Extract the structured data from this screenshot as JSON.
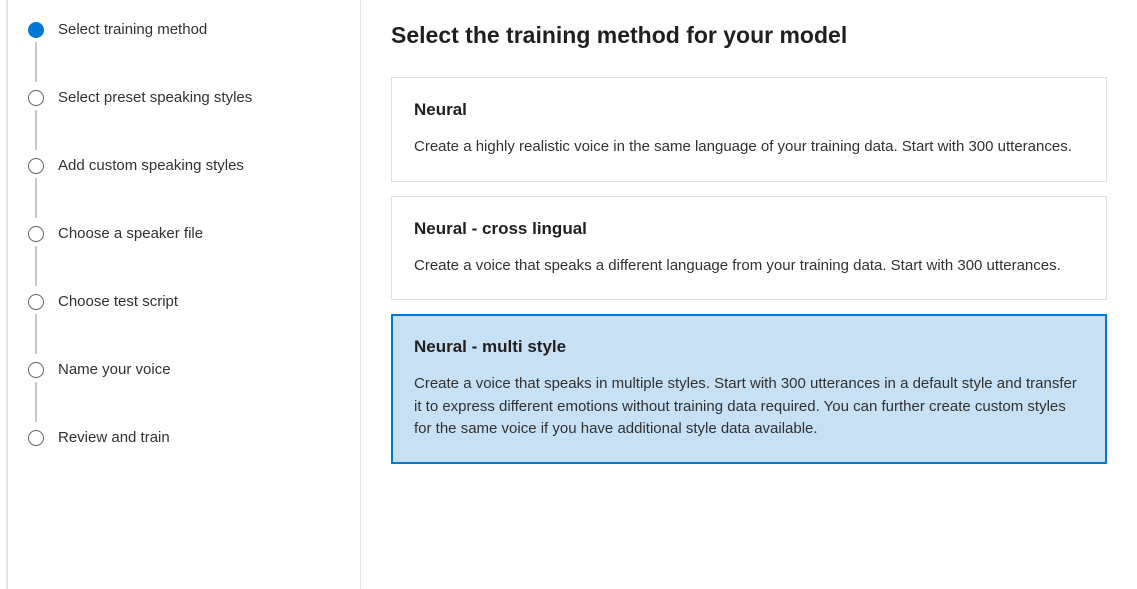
{
  "sidebar": {
    "steps": [
      {
        "label": "Select training method",
        "active": true
      },
      {
        "label": "Select preset speaking styles",
        "active": false
      },
      {
        "label": "Add custom speaking styles",
        "active": false
      },
      {
        "label": "Choose a speaker file",
        "active": false
      },
      {
        "label": "Choose test script",
        "active": false
      },
      {
        "label": "Name your voice",
        "active": false
      },
      {
        "label": "Review and train",
        "active": false
      }
    ]
  },
  "main": {
    "title": "Select the training method for your model",
    "options": [
      {
        "title": "Neural",
        "desc": "Create a highly realistic voice in the same language of your training data. Start with 300 utterances.",
        "selected": false
      },
      {
        "title": "Neural - cross lingual",
        "desc": "Create a voice that speaks a different language from your training data. Start with 300 utterances.",
        "selected": false
      },
      {
        "title": "Neural - multi style",
        "desc": "Create a voice that speaks in multiple styles. Start with 300 utterances in a default style and transfer it to express different emotions without training data required. You can further create custom styles for the same voice if you have additional style data available.",
        "selected": true
      }
    ]
  }
}
